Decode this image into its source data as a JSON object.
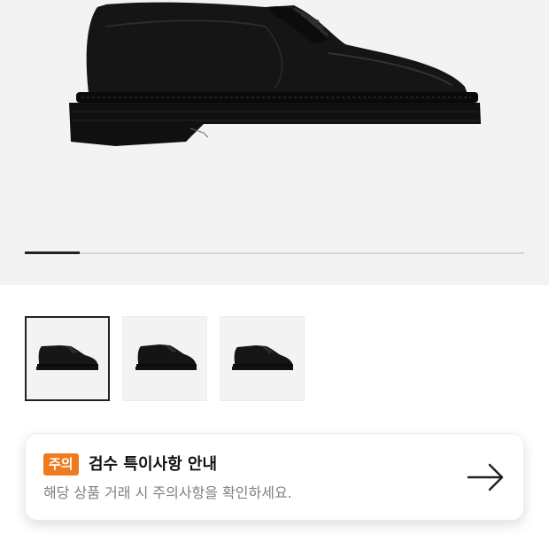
{
  "hero": {
    "image_icon": "black-derby-shoe-image",
    "slide_progress": 0.11
  },
  "thumbnails": [
    {
      "icon": "shoe-thumbnail-1",
      "selected": true
    },
    {
      "icon": "shoe-thumbnail-2",
      "selected": false
    },
    {
      "icon": "shoe-thumbnail-3",
      "selected": false
    }
  ],
  "notice": {
    "badge": "주의",
    "title": "검수 특이사항 안내",
    "subtitle": "해당 상품 거래 시 주의사항을 확인하세요.",
    "arrow_icon": "arrow-right-icon"
  },
  "colors": {
    "badge_bg": "#ef7b1e",
    "hero_bg": "#f3f3f3",
    "text_primary": "#111111",
    "text_secondary": "#808080"
  }
}
